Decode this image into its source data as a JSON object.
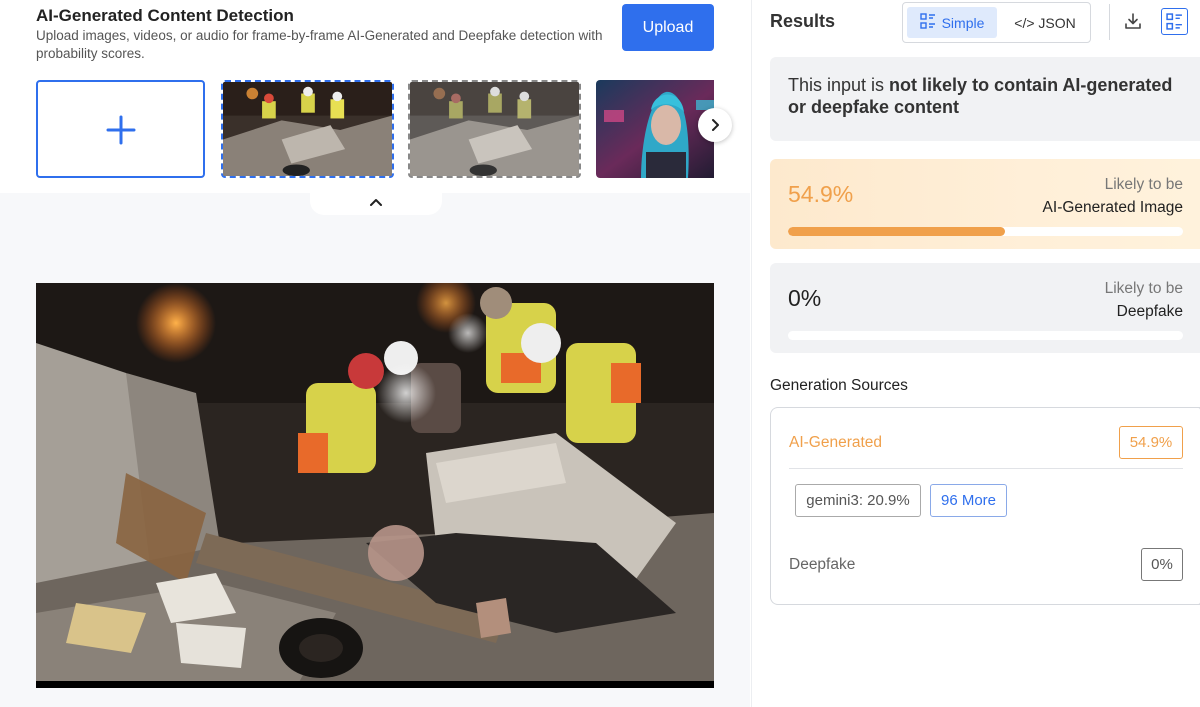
{
  "header": {
    "title": "AI-Generated Content Detection",
    "subtitle": "Upload images, videos, or audio for frame-by-frame AI-Generated and Deepfake detection with probability scores.",
    "upload_label": "Upload"
  },
  "thumbnails": {
    "add_icon": "plus-icon",
    "items": [
      {
        "name": "rescue-scene",
        "selected": true
      },
      {
        "name": "rescue-scene",
        "selected": false
      },
      {
        "name": "cyberpunk-portrait",
        "selected": false
      }
    ],
    "next_icon": "chevron-right-icon",
    "collapse_icon": "chevron-up-icon"
  },
  "results": {
    "title": "Results",
    "view_toggle": {
      "simple_label": "Simple",
      "json_label": "</> JSON",
      "active": "Simple"
    },
    "verdict_prefix": "This input is ",
    "verdict_emphasis": "not likely to contain AI-generated or deepfake content",
    "ai_card": {
      "percent": "54.9%",
      "value": 0.549,
      "likely_label": "Likely to be",
      "category": "AI-Generated Image",
      "color": "#f0a04b"
    },
    "deepfake_card": {
      "percent": "0%",
      "value": 0.0,
      "likely_label": "Likely to be",
      "category": "Deepfake"
    }
  },
  "generation_sources": {
    "title": "Generation Sources",
    "ai_generated": {
      "label": "AI-Generated",
      "percent": "54.9%"
    },
    "chips": {
      "gemini": "gemini3: 20.9%",
      "more": "96 More"
    },
    "deepfake": {
      "label": "Deepfake",
      "percent": "0%"
    }
  },
  "colors": {
    "accent": "#2f6fed",
    "ai_orange": "#f0a04b"
  }
}
